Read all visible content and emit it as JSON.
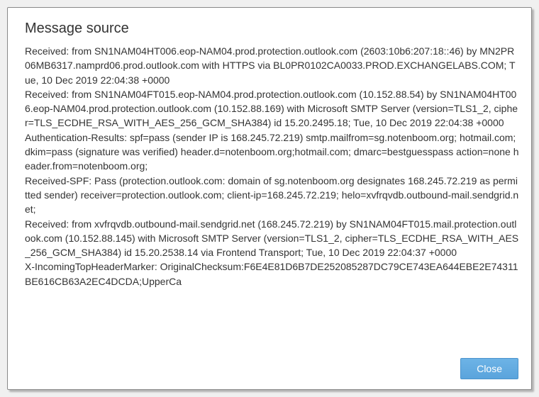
{
  "dialog": {
    "title": "Message source",
    "close_label": "Close"
  },
  "headers_text": "Received: from SN1NAM04HT006.eop-NAM04.prod.protection.outlook.com (2603:10b6:207:18::46) by MN2PR06MB6317.namprd06.prod.outlook.com with HTTPS via BL0PR0102CA0033.PROD.EXCHANGELABS.COM; Tue, 10 Dec 2019 22:04:38 +0000\nReceived: from SN1NAM04FT015.eop-NAM04.prod.protection.outlook.com (10.152.88.54) by SN1NAM04HT006.eop-NAM04.prod.protection.outlook.com (10.152.88.169) with Microsoft SMTP Server (version=TLS1_2, cipher=TLS_ECDHE_RSA_WITH_AES_256_GCM_SHA384) id 15.20.2495.18; Tue, 10 Dec 2019 22:04:38 +0000\nAuthentication-Results: spf=pass (sender IP is 168.245.72.219) smtp.mailfrom=sg.notenboom.org; hotmail.com; dkim=pass (signature was verified) header.d=notenboom.org;hotmail.com; dmarc=bestguesspass action=none header.from=notenboom.org;\nReceived-SPF: Pass (protection.outlook.com: domain of sg.notenboom.org designates 168.245.72.219 as permitted sender) receiver=protection.outlook.com; client-ip=168.245.72.219; helo=xvfrqvdb.outbound-mail.sendgrid.net;\nReceived: from xvfrqvdb.outbound-mail.sendgrid.net (168.245.72.219) by SN1NAM04FT015.mail.protection.outlook.com (10.152.88.145) with Microsoft SMTP Server (version=TLS1_2, cipher=TLS_ECDHE_RSA_WITH_AES_256_GCM_SHA384) id 15.20.2538.14 via Frontend Transport; Tue, 10 Dec 2019 22:04:37 +0000\nX-IncomingTopHeaderMarker: OriginalChecksum:F6E4E81D6B7DE252085287DC79CE743EA644EBE2E74311BE616CB63A2EC4DCDA;UpperCa"
}
